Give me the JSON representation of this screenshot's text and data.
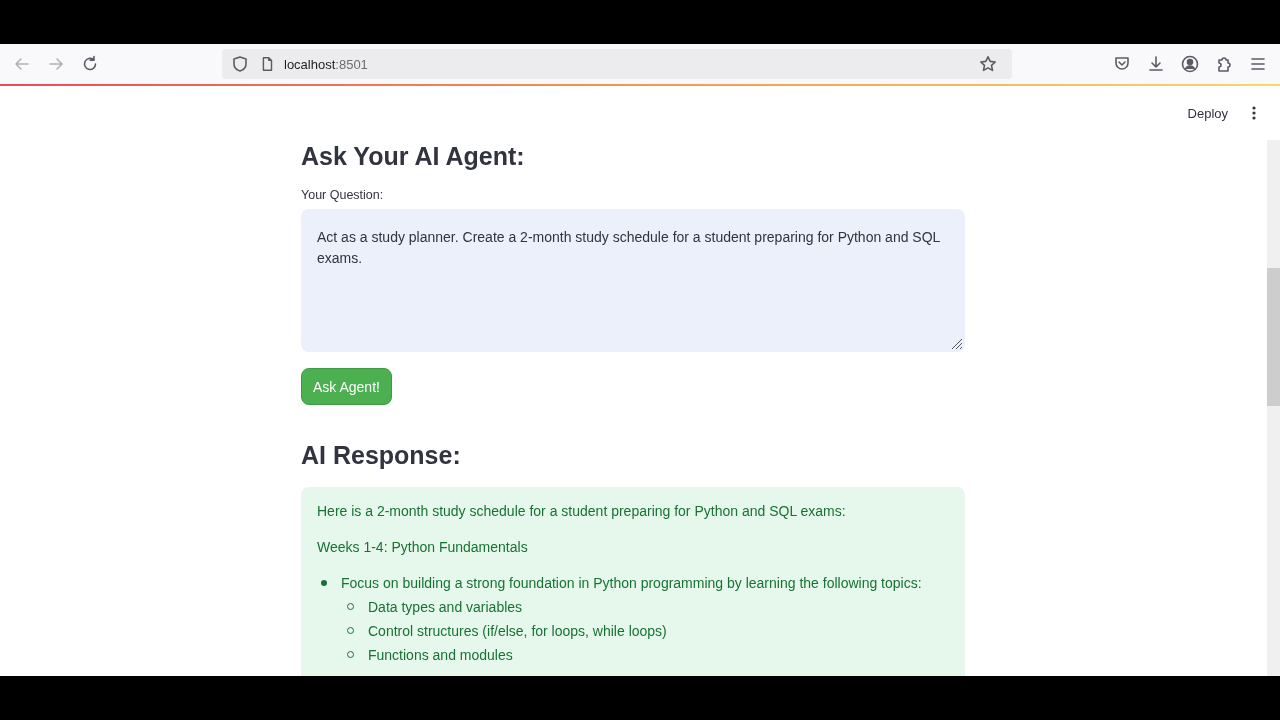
{
  "browser": {
    "url_host": "localhost",
    "url_port": ":8501"
  },
  "app_header": {
    "deploy": "Deploy"
  },
  "main": {
    "title": "Ask Your AI Agent:",
    "question": {
      "label": "Your Question:",
      "value": "Act as a study planner. Create a 2-month study schedule for a student preparing for Python and SQL exams."
    },
    "button": "Ask Agent!",
    "response_title": "AI Response:",
    "response": {
      "intro": "Here is a 2-month study schedule for a student preparing for Python and SQL exams:",
      "section": "Weeks 1-4: Python Fundamentals",
      "bullets": [
        {
          "text": "Focus on building a strong foundation in Python programming by learning the following topics:",
          "children": [
            {
              "text": "Data types and variables"
            },
            {
              "text": "Control structures (if/else, for loops, while loops)"
            },
            {
              "text": "Functions and modules"
            }
          ]
        }
      ]
    }
  }
}
